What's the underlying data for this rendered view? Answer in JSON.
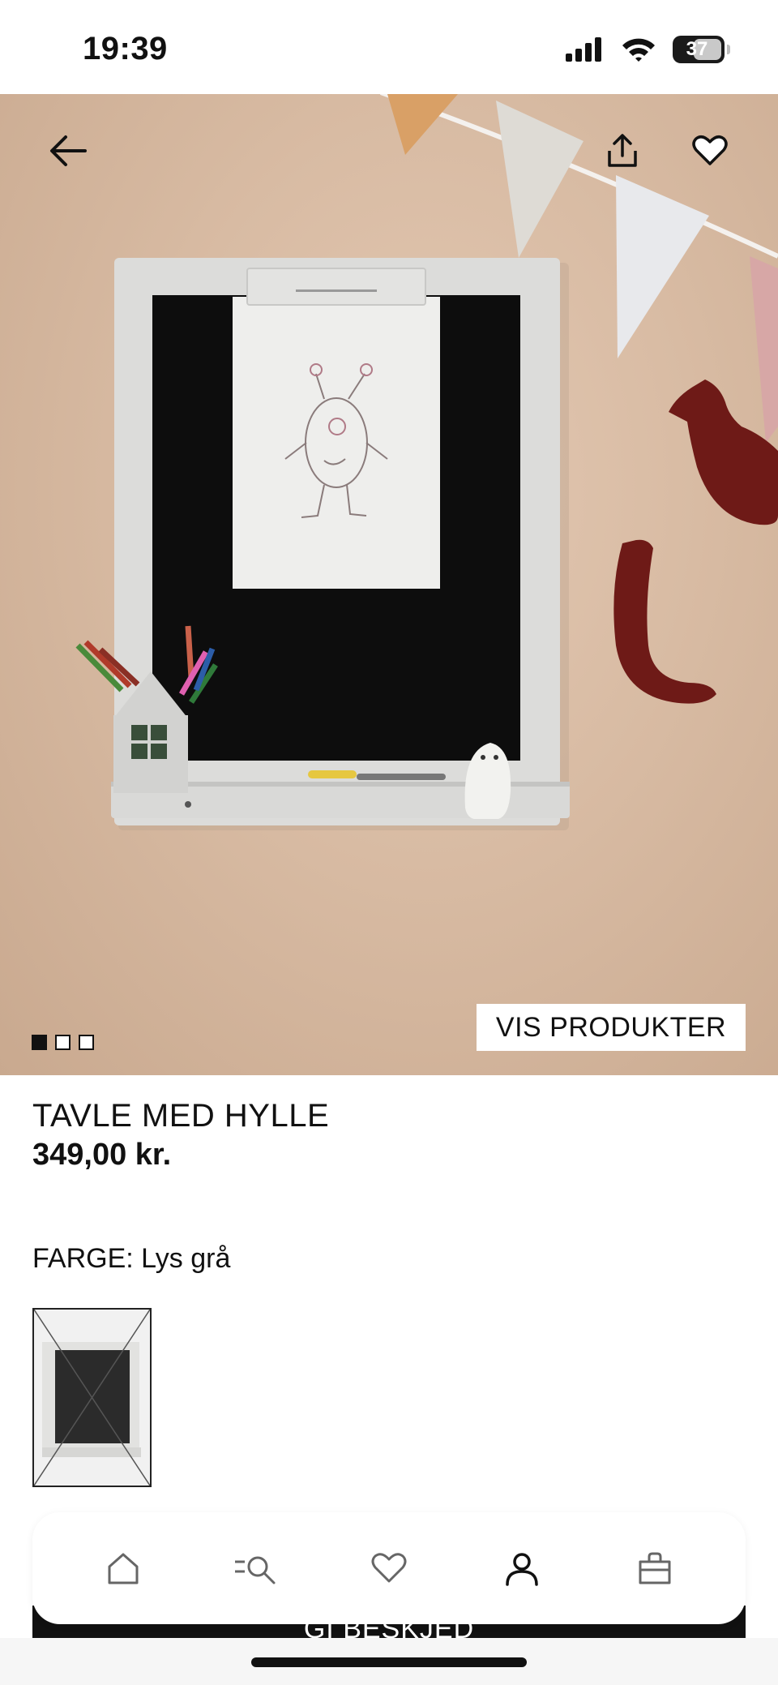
{
  "status_bar": {
    "time": "19:39",
    "battery": "37",
    "icons": [
      "cellular-signal-icon",
      "wifi-icon",
      "battery-icon"
    ]
  },
  "hero": {
    "icons": [
      "back-arrow-icon",
      "share-icon",
      "heart-icon"
    ],
    "carousel": {
      "count": 3,
      "active_index": 0
    },
    "view_products_label": "VIS PRODUKTER"
  },
  "product": {
    "name": "TAVLE MED HYLLE",
    "price": "349,00 kr.",
    "color_label": "FARGE: Lys grå"
  },
  "bottom_nav": {
    "items": [
      {
        "icon": "home-icon"
      },
      {
        "icon": "search-icon"
      },
      {
        "icon": "heart-icon"
      },
      {
        "icon": "profile-icon"
      },
      {
        "icon": "bag-icon"
      }
    ],
    "cta_label": "GI BESKJED"
  },
  "colors": {
    "wall": "#d8bba3",
    "board_frame": "#dcdcda",
    "chalkboard": "#0d0d0d",
    "accent_dark": "#111111"
  }
}
